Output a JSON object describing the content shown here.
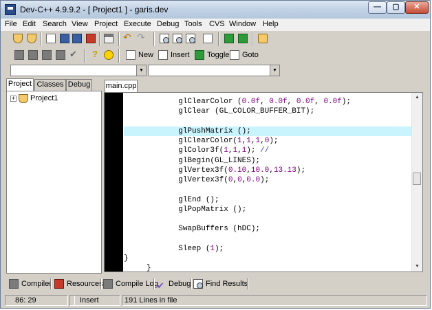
{
  "window": {
    "title": "Dev-C++ 4.9.9.2  - [ Project1 ] - garis.dev",
    "controls": {
      "minimize": "—",
      "maximize": "▢",
      "close": "✕"
    }
  },
  "menu": [
    "File",
    "Edit",
    "Search",
    "View",
    "Project",
    "Execute",
    "Debug",
    "Tools",
    "CVS",
    "Window",
    "Help"
  ],
  "toolbar2": {
    "new_label": "New",
    "insert_label": "Insert",
    "toggle_label": "Toggle",
    "goto_label": "Goto"
  },
  "combos": {
    "class_combo": "",
    "member_combo": ""
  },
  "left_panel": {
    "tabs": [
      "Project",
      "Classes",
      "Debug"
    ],
    "tree": {
      "expander": "+",
      "root": "Project1"
    }
  },
  "editor": {
    "file_tab": "main.cpp",
    "lines": [
      {
        "indent": "            ",
        "tokens": [
          {
            "t": "glClearColor (",
            "k": "t"
          },
          {
            "t": "0.0f",
            "k": "n"
          },
          {
            "t": ", ",
            "k": "t"
          },
          {
            "t": "0.0f",
            "k": "n"
          },
          {
            "t": ", ",
            "k": "t"
          },
          {
            "t": "0.0f",
            "k": "n"
          },
          {
            "t": ", ",
            "k": "t"
          },
          {
            "t": "0.0f",
            "k": "n"
          },
          {
            "t": ");",
            "k": "t"
          }
        ]
      },
      {
        "indent": "            ",
        "tokens": [
          {
            "t": "glClear (GL_COLOR_BUFFER_BIT);",
            "k": "t"
          }
        ]
      },
      {
        "indent": "",
        "tokens": []
      },
      {
        "indent": "            ",
        "tokens": [
          {
            "t": "glPushMatrix ();",
            "k": "t"
          }
        ],
        "highlight": true
      },
      {
        "indent": "            ",
        "tokens": [
          {
            "t": "glClearColor(",
            "k": "t"
          },
          {
            "t": "1",
            "k": "n"
          },
          {
            "t": ",",
            "k": "t"
          },
          {
            "t": "1",
            "k": "n"
          },
          {
            "t": ",",
            "k": "t"
          },
          {
            "t": "1",
            "k": "n"
          },
          {
            "t": ",",
            "k": "t"
          },
          {
            "t": "0",
            "k": "n"
          },
          {
            "t": ");",
            "k": "t"
          }
        ]
      },
      {
        "indent": "            ",
        "tokens": [
          {
            "t": "glColor3f(",
            "k": "t"
          },
          {
            "t": "1",
            "k": "n"
          },
          {
            "t": ",",
            "k": "t"
          },
          {
            "t": "1",
            "k": "n"
          },
          {
            "t": ",",
            "k": "t"
          },
          {
            "t": "1",
            "k": "n"
          },
          {
            "t": "); ",
            "k": "t"
          },
          {
            "t": "//",
            "k": "c"
          }
        ]
      },
      {
        "indent": "            ",
        "tokens": [
          {
            "t": "glBegin(GL_LINES);",
            "k": "t"
          }
        ]
      },
      {
        "indent": "            ",
        "tokens": [
          {
            "t": "glVertex3f(",
            "k": "t"
          },
          {
            "t": "0.10",
            "k": "n"
          },
          {
            "t": ",",
            "k": "t"
          },
          {
            "t": "10.0",
            "k": "n"
          },
          {
            "t": ",",
            "k": "t"
          },
          {
            "t": "13.13",
            "k": "n"
          },
          {
            "t": ");",
            "k": "t"
          }
        ]
      },
      {
        "indent": "            ",
        "tokens": [
          {
            "t": "glVertex3f(",
            "k": "t"
          },
          {
            "t": "0",
            "k": "n"
          },
          {
            "t": ",",
            "k": "t"
          },
          {
            "t": "0",
            "k": "n"
          },
          {
            "t": ",",
            "k": "t"
          },
          {
            "t": "0.0",
            "k": "n"
          },
          {
            "t": ");",
            "k": "t"
          }
        ]
      },
      {
        "indent": "",
        "tokens": []
      },
      {
        "indent": "            ",
        "tokens": [
          {
            "t": "glEnd ();",
            "k": "t"
          }
        ]
      },
      {
        "indent": "            ",
        "tokens": [
          {
            "t": "glPopMatrix ();",
            "k": "t"
          }
        ]
      },
      {
        "indent": "",
        "tokens": []
      },
      {
        "indent": "            ",
        "tokens": [
          {
            "t": "SwapBuffers (hDC);",
            "k": "t"
          }
        ]
      },
      {
        "indent": "",
        "tokens": []
      },
      {
        "indent": "            ",
        "tokens": [
          {
            "t": "Sleep (",
            "k": "t"
          },
          {
            "t": "1",
            "k": "n"
          },
          {
            "t": ");",
            "k": "t"
          }
        ]
      },
      {
        "indent": "",
        "tokens": [
          {
            "t": "}",
            "k": "t"
          }
        ]
      },
      {
        "indent": "     ",
        "tokens": [
          {
            "t": "}",
            "k": "t"
          }
        ]
      }
    ]
  },
  "bottom_tabs": [
    "Compiler",
    "Resources",
    "Compile Log",
    "Debug",
    "Find Results"
  ],
  "status": {
    "position": "86: 29",
    "modified": "",
    "mode": "Insert",
    "lines_info": "191 Lines in file"
  }
}
